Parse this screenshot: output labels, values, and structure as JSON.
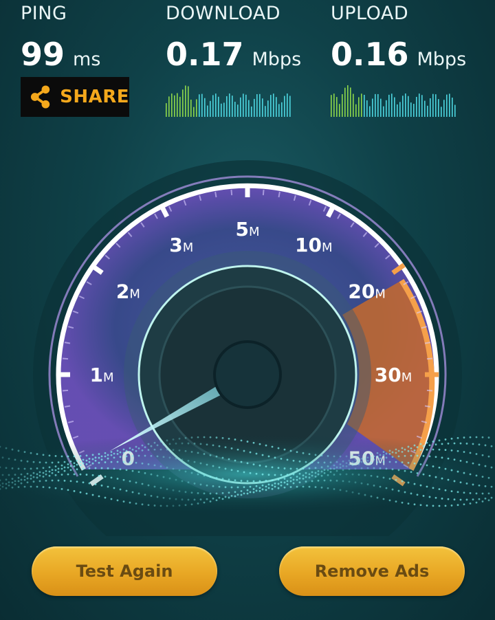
{
  "ping": {
    "label": "PING",
    "value": "99",
    "unit": "ms"
  },
  "download": {
    "label": "DOWNLOAD",
    "value": "0.17",
    "unit": "Mbps"
  },
  "upload": {
    "label": "UPLOAD",
    "value": "0.16",
    "unit": "Mbps"
  },
  "share": {
    "label": "SHARE",
    "icon": "share-icon",
    "color": "#f4a81c"
  },
  "gauge": {
    "ticks": [
      {
        "num": "0",
        "unit": ""
      },
      {
        "num": "1",
        "unit": "M"
      },
      {
        "num": "2",
        "unit": "M"
      },
      {
        "num": "3",
        "unit": "M"
      },
      {
        "num": "5",
        "unit": "M"
      },
      {
        "num": "10",
        "unit": "M"
      },
      {
        "num": "20",
        "unit": "M"
      },
      {
        "num": "30",
        "unit": "M"
      },
      {
        "num": "50",
        "unit": "M"
      }
    ],
    "needle_value_mbps": 0.17,
    "accent_purple": "#8a6ad8",
    "accent_orange": "#f08a2a"
  },
  "buttons": {
    "test_again": "Test Again",
    "remove_ads": "Remove Ads"
  }
}
